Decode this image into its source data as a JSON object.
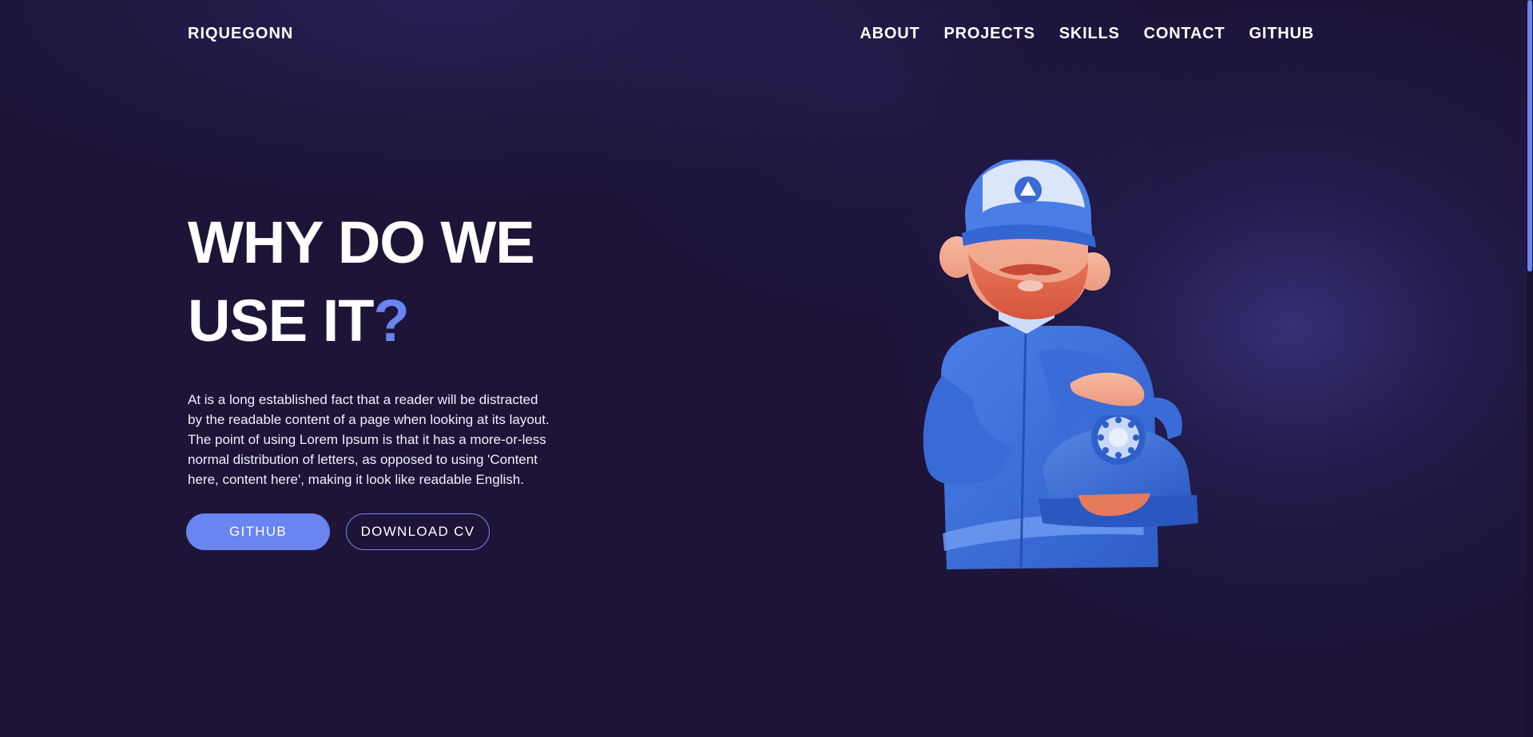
{
  "header": {
    "brand": "RIQUEGONN",
    "nav": [
      {
        "label": "ABOUT"
      },
      {
        "label": "PROJECTS"
      },
      {
        "label": "SKILLS"
      },
      {
        "label": "CONTACT"
      },
      {
        "label": "GITHUB"
      }
    ]
  },
  "hero": {
    "title_line1": "WHY DO WE",
    "title_line2": "USE IT",
    "title_mark": "?",
    "description": "At is a long established fact that a reader will be distracted by the readable content of a page when looking at its layout. The point of using Lorem Ipsum is that it has a more-or-less normal distribution of letters, as opposed to using 'Content here, content here', making it look like readable English.",
    "primary_button": "GITHUB",
    "secondary_button": "DOWNLOAD CV"
  },
  "colors": {
    "background": "#1d1437",
    "accent": "#6a84f0",
    "text": "#ffffff"
  },
  "illustration": {
    "icon": "man-with-rotary-phone-illustration"
  }
}
